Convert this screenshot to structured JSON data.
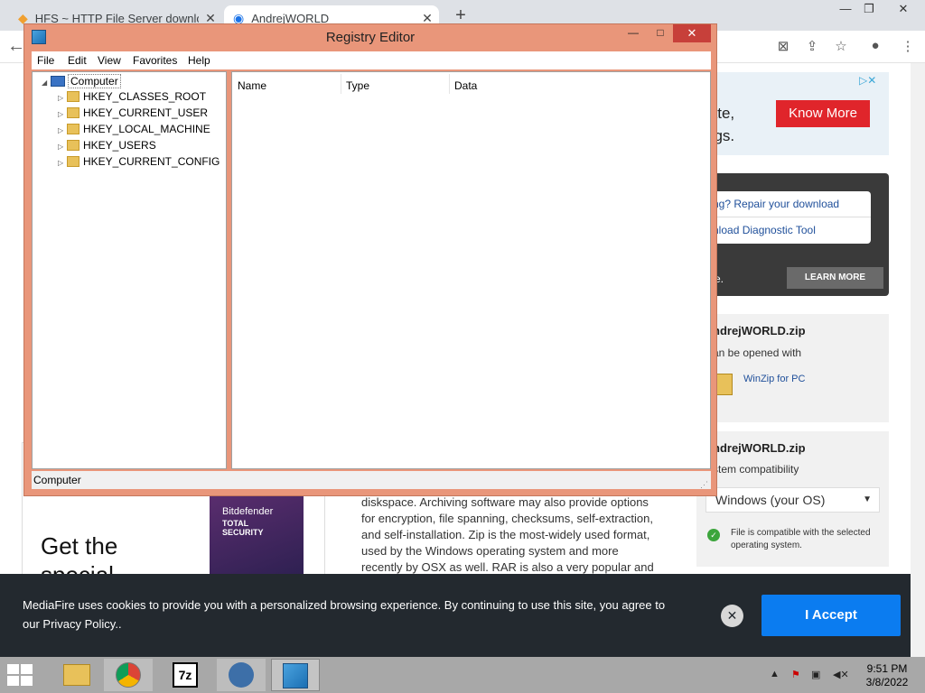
{
  "browser": {
    "tabs": [
      {
        "title": "HFS ~ HTTP File Server download",
        "active": false
      },
      {
        "title": "AndrejWORLD",
        "active": true
      }
    ],
    "newtab": "+",
    "window_buttons": {
      "min": "—",
      "max": "❐",
      "close": "✕"
    }
  },
  "page": {
    "ad": {
      "line1": "late,",
      "line2": "ogs.",
      "cta": "Know More",
      "adchoice": "▷✕"
    },
    "download_help": {
      "line1": "ng? Repair your download",
      "line2": "nload Diagnostic Tool",
      "tail": "e.",
      "cta": "LEARN MORE"
    },
    "card1": {
      "title": "ndrejWORLD.zip",
      "sub": "an be opened with",
      "app": "WinZip for PC"
    },
    "card2": {
      "title": "ndrejWORLD.zip",
      "sub": "stem compatibility",
      "os": "Windows (your OS)",
      "compat": "File is compatible with the selected operating system."
    },
    "promo": {
      "headline_1": "Get the",
      "headline_2": "special",
      "product_1": "Bitdefender",
      "product_2": "TOTAL SECURITY"
    },
    "body": "diskspace. Archiving software may also provide options for encryption, file spanning, checksums, self-extraction, and self-installation. Zip is the most-widely used format, used by the Windows operating system and more recently by OSX as well. RAR is also a very popular and"
  },
  "registry": {
    "title": "Registry Editor",
    "menu": [
      "File",
      "Edit",
      "View",
      "Favorites",
      "Help"
    ],
    "root": "Computer",
    "keys": [
      "HKEY_CLASSES_ROOT",
      "HKEY_CURRENT_USER",
      "HKEY_LOCAL_MACHINE",
      "HKEY_USERS",
      "HKEY_CURRENT_CONFIG"
    ],
    "columns": [
      "Name",
      "Type",
      "Data"
    ],
    "status": "Computer",
    "buttons": {
      "min": "—",
      "max": "□",
      "close": "✕"
    }
  },
  "cookie": {
    "text": "MediaFire uses cookies to provide you with a personalized browsing experience. By continuing to use this site, you agree to our Privacy Policy..",
    "accept": "I Accept",
    "close": "✕"
  },
  "taskbar": {
    "time": "9:51 PM",
    "date": "3/8/2022",
    "sevenzip": "7z"
  },
  "colors": {
    "window_frame": "#e9967a",
    "accept": "#0b7cf0",
    "ad_cta": "#e0252b"
  }
}
